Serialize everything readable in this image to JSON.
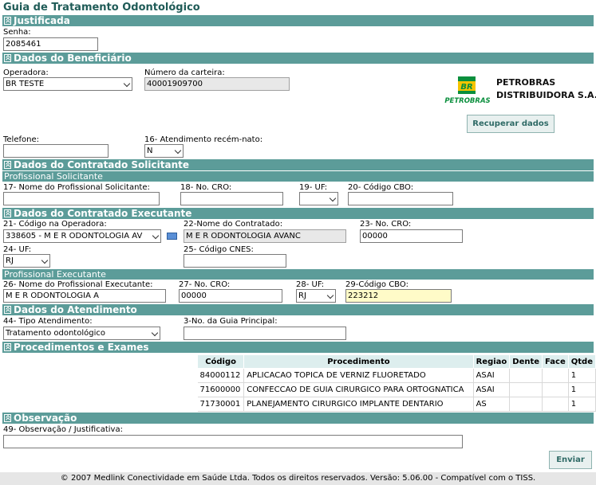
{
  "page_title": "Guia de Tratamento Odontológico",
  "sections": {
    "justificada": "Justificada",
    "beneficiario": "Dados do Beneficiário",
    "contratado_solicitante": "Dados do Contratado Solicitante",
    "profissional_solicitante": "Profissional Solicitante",
    "contratado_executante": "Dados do Contratado Executante",
    "profissional_executante": "Profissional Executante",
    "atendimento": "Dados do Atendimento",
    "procedimentos": "Procedimentos e Exames",
    "observacao": "Observação"
  },
  "fields": {
    "senha_label": "Senha:",
    "senha_value": "2085461",
    "operadora_label": "Operadora:",
    "operadora_value": "BR TESTE",
    "carteira_label": "Número da carteira:",
    "carteira_value": "40001909700",
    "telefone_label": "Telefone:",
    "telefone_value": "",
    "recem_nato_label": "16- Atendimento recém-nato:",
    "recem_nato_value": "N",
    "nome_solicitante_label": "17- Nome do Profissional Solicitante:",
    "cro_solicitante_label": "18- No. CRO:",
    "uf_solicitante_label": "19- UF:",
    "cbo_solicitante_label": "20- Código CBO:",
    "codigo_operadora_label": "21- Código na Operadora:",
    "codigo_operadora_value": "338605 - M E R ODONTOLOGIA AV",
    "nome_contratado_label": "22-Nome do Contratado:",
    "nome_contratado_value": "M E R ODONTOLOGIA AVANC",
    "cro_contratado_label": "23- No. CRO:",
    "cro_contratado_value": "00000",
    "uf_contratado_label": "24- UF:",
    "uf_contratado_value": "RJ",
    "cnes_label": "25- Código CNES:",
    "nome_executante_label": "26- Nome do Profissional Executante:",
    "nome_executante_value": "M E R ODONTOLOGIA A",
    "cro_executante_label": "27- No. CRO:",
    "cro_executante_value": "00000",
    "uf_executante_label": "28- UF:",
    "uf_executante_value": "RJ",
    "cbo_executante_label": "29-Código CBO:",
    "cbo_executante_value": "223212",
    "tipo_atendimento_label": "44- Tipo Atendimento:",
    "tipo_atendimento_value": "Tratamento odontológico",
    "guia_principal_label": "3-No. da Guia Principal:",
    "observacao_label": "49- Observação / Justificativa:"
  },
  "logo": {
    "brand": "PETROBRAS",
    "br": "BR",
    "company_line1": "PETROBRAS",
    "company_line2": "DISTRIBUIDORA S.A."
  },
  "buttons": {
    "recuperar": "Recuperar dados",
    "enviar": "Enviar"
  },
  "table": {
    "headers": [
      "Código",
      "Procedimento",
      "Regiao",
      "Dente",
      "Face",
      "Qtde"
    ],
    "rows": [
      [
        "84000112",
        "APLICACAO TOPICA DE VERNIZ FLUORETADO",
        "ASAI",
        "",
        "",
        "1"
      ],
      [
        "71600000",
        "CONFECCAO DE GUIA CIRURGICO PARA ORTOGNATICA",
        "ASAI",
        "",
        "",
        "1"
      ],
      [
        "71730001",
        "PLANEJAMENTO CIRURGICO IMPLANTE DENTARIO",
        "AS",
        "",
        "",
        "1"
      ]
    ]
  },
  "footer": "© 2007  Medlink Conectividade em Saúde Ltda.   Todos os direitos reservados.   Versão: 5.06.00 - Compatível com o TISS."
}
